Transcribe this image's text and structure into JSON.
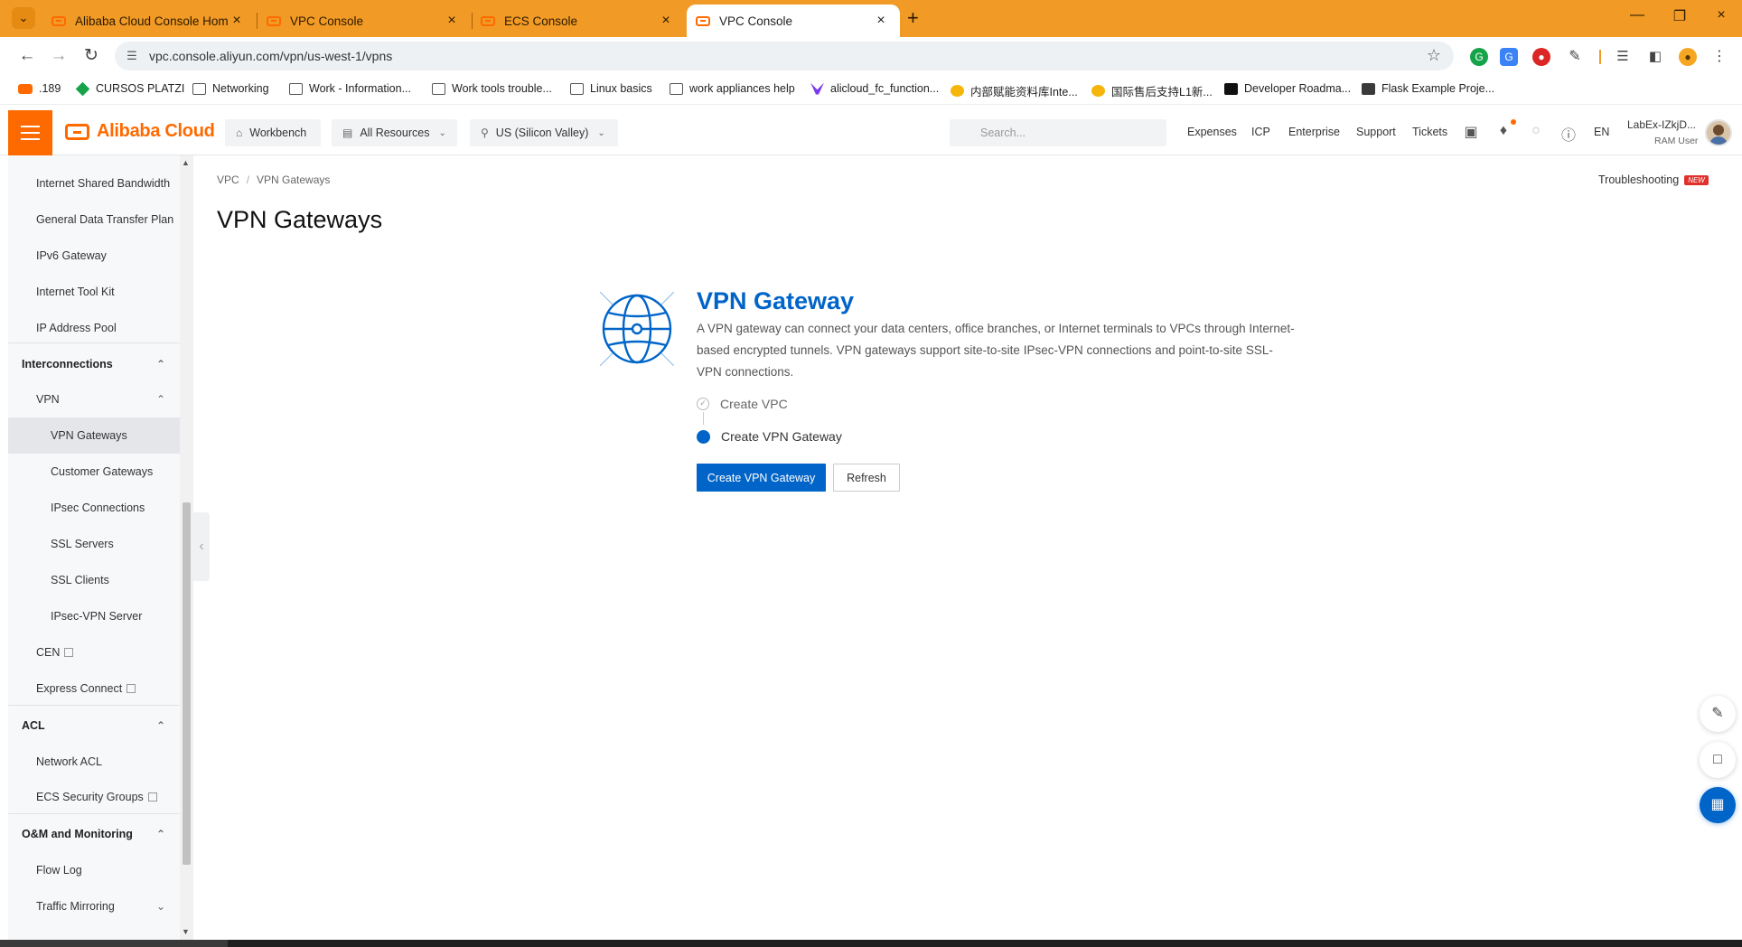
{
  "browser": {
    "tabs": [
      {
        "title": "Alibaba Cloud Console Home"
      },
      {
        "title": "VPC Console"
      },
      {
        "title": "ECS Console"
      },
      {
        "title": "VPC Console"
      }
    ],
    "active_tab_index": 3,
    "url": "vpc.console.aliyun.com/vpn/us-west-1/vpns",
    "bookmarks": [
      {
        "label": ".189",
        "icon": "alibaba-icon"
      },
      {
        "label": "CURSOS PLATZI",
        "icon": "platzi-icon"
      },
      {
        "label": "Networking",
        "icon": "folder-icon"
      },
      {
        "label": "Work - Information...",
        "icon": "folder-icon"
      },
      {
        "label": "Work tools trouble...",
        "icon": "folder-icon"
      },
      {
        "label": "Linux basics",
        "icon": "folder-icon"
      },
      {
        "label": "work appliances help",
        "icon": "folder-icon"
      },
      {
        "label": "alicloud_fc_function...",
        "icon": "terraform-icon"
      },
      {
        "label": "内部赋能资料库Inte...",
        "icon": "yuque-icon"
      },
      {
        "label": "国际售后支持L1新...",
        "icon": "yuque-icon"
      },
      {
        "label": "Developer Roadma...",
        "icon": "roadmap-icon"
      },
      {
        "label": "Flask Example Proje...",
        "icon": "flask-icon"
      }
    ]
  },
  "header": {
    "brand": "Alibaba Cloud",
    "workbench": "Workbench",
    "all_resources": "All Resources",
    "region": "US (Silicon Valley)",
    "search_placeholder": "Search...",
    "links": [
      "Expenses",
      "ICP",
      "Enterprise",
      "Support",
      "Tickets"
    ],
    "language": "EN",
    "user_name": "LabEx-IZkjD...",
    "user_role": "RAM User"
  },
  "sidebar": {
    "items": [
      {
        "label": "Internet Shared Bandwidth",
        "level": 1
      },
      {
        "label": "General Data Transfer Plan",
        "level": 1
      },
      {
        "label": "IPv6 Gateway",
        "level": 1
      },
      {
        "label": "Internet Tool Kit",
        "level": 1
      },
      {
        "label": "IP Address Pool",
        "level": 1
      },
      {
        "label": "Interconnections",
        "level": 0
      },
      {
        "label": "VPN",
        "level": 1
      },
      {
        "label": "VPN Gateways",
        "level": 2
      },
      {
        "label": "Customer Gateways",
        "level": 2
      },
      {
        "label": "IPsec Connections",
        "level": 2
      },
      {
        "label": "SSL Servers",
        "level": 2
      },
      {
        "label": "SSL Clients",
        "level": 2
      },
      {
        "label": "IPsec-VPN Server",
        "level": 2
      },
      {
        "label": "CEN",
        "level": 1
      },
      {
        "label": "Express Connect",
        "level": 1
      },
      {
        "label": "ACL",
        "level": 0
      },
      {
        "label": "Network ACL",
        "level": 1
      },
      {
        "label": "ECS Security Groups",
        "level": 1
      },
      {
        "label": "O&M and Monitoring",
        "level": 0
      },
      {
        "label": "Flow Log",
        "level": 1
      },
      {
        "label": "Traffic Mirroring",
        "level": 1
      }
    ],
    "active": "VPN Gateways"
  },
  "main": {
    "breadcrumb": [
      "VPC",
      "VPN Gateways"
    ],
    "troubleshooting": "Troubleshooting",
    "new_badge": "NEW",
    "page_title": "VPN Gateways",
    "hero_title": "VPN Gateway",
    "hero_description": "A VPN gateway can connect your data centers, office branches, or Internet terminals to VPCs through Internet-based encrypted tunnels. VPN gateways support site-to-site IPsec-VPN connections and point-to-site SSL-VPN connections.",
    "steps": [
      {
        "label": "Create VPC",
        "status": "done"
      },
      {
        "label": "Create VPN Gateway",
        "status": "current"
      }
    ],
    "primary_button": "Create VPN Gateway",
    "secondary_button": "Refresh"
  },
  "colors": {
    "chrome_orange": "#f19a25",
    "brand_orange": "#ff6a00",
    "primary_blue": "#0064c8"
  }
}
